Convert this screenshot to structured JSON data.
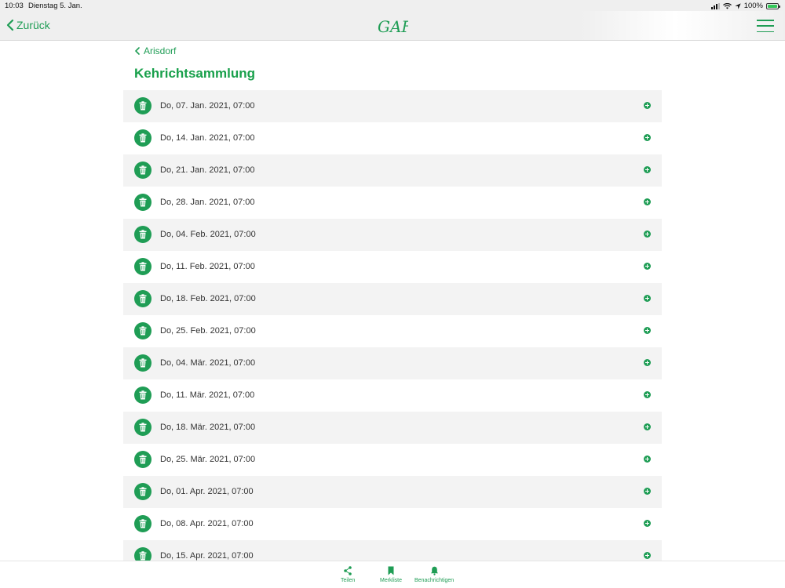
{
  "status_bar": {
    "time": "10:03",
    "date": "Dienstag 5. Jan.",
    "battery_percent": "100%"
  },
  "nav": {
    "back_label": "Zurück",
    "logo_text": "GAF",
    "accent_color": "#1f9d55"
  },
  "breadcrumb": {
    "label": "Arisdorf"
  },
  "page_title": "Kehrichtsammlung",
  "collections": [
    "Do, 07. Jan. 2021, 07:00",
    "Do, 14. Jan. 2021, 07:00",
    "Do, 21. Jan. 2021, 07:00",
    "Do, 28. Jan. 2021, 07:00",
    "Do, 04. Feb. 2021, 07:00",
    "Do, 11. Feb. 2021, 07:00",
    "Do, 18. Feb. 2021, 07:00",
    "Do, 25. Feb. 2021, 07:00",
    "Do, 04. Mär. 2021, 07:00",
    "Do, 11. Mär. 2021, 07:00",
    "Do, 18. Mär. 2021, 07:00",
    "Do, 25. Mär. 2021, 07:00",
    "Do, 01. Apr. 2021, 07:00",
    "Do, 08. Apr. 2021, 07:00",
    "Do, 15. Apr. 2021, 07:00"
  ],
  "row_icons": {
    "leading": "trash-icon",
    "trailing": "plus-circle-icon"
  },
  "tab_bar": {
    "share": "Teilen",
    "bookmarks": "Merkliste",
    "notify": "Benachrichtigen"
  }
}
